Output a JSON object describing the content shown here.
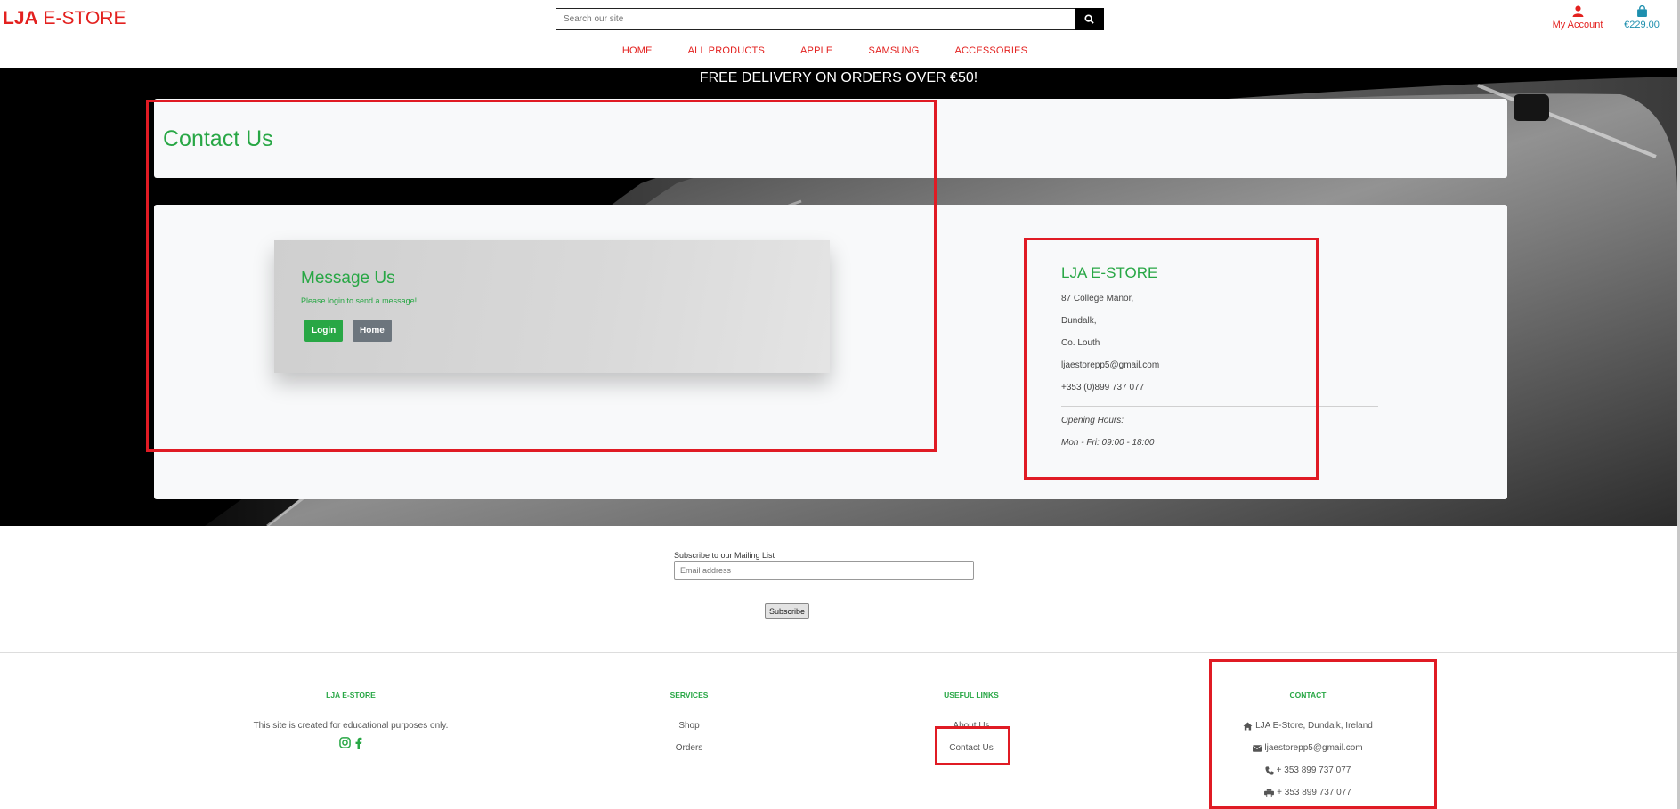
{
  "header": {
    "brand_bold": "LJA",
    "brand_rest": " E-STORE",
    "search_placeholder": "Search our site",
    "account_label": "My Account",
    "cart_total": "€229.00",
    "nav": [
      "HOME",
      "ALL PRODUCTS",
      "APPLE",
      "SAMSUNG",
      "ACCESSORIES"
    ]
  },
  "banner": "FREE DELIVERY ON ORDERS OVER €50!",
  "page_title": "Contact Us",
  "message": {
    "title": "Message Us",
    "note": "Please login to send a message!",
    "login_label": "Login",
    "home_label": "Home"
  },
  "store": {
    "name": "LJA E-STORE",
    "lines": [
      "87 College Manor,",
      "Dundalk,",
      "Co. Louth",
      "ljaestorepp5@gmail.com",
      "+353 (0)899 737 077"
    ],
    "hours_label": "Opening Hours:",
    "hours": "Mon - Fri: 09:00 - 18:00"
  },
  "mailing": {
    "label": "Subscribe to our Mailing List",
    "placeholder": "Email address",
    "button": "Subscribe"
  },
  "footer": {
    "about": {
      "title": "LJA E-STORE",
      "text": "This site is created for educational purposes only.",
      "icons": [
        "instagram-icon",
        "facebook-icon"
      ]
    },
    "services": {
      "title": "SERVICES",
      "links": [
        "Shop",
        "Orders"
      ]
    },
    "useful": {
      "title": "USEFUL LINKS",
      "links": [
        "About Us",
        "Contact Us"
      ]
    },
    "contact": {
      "title": "CONTACT",
      "address": "LJA E-Store, Dundalk, Ireland",
      "email": "ljaestorepp5@gmail.com",
      "phone": "+ 353 899 737 077",
      "fax": "+ 353 899 737 077"
    }
  },
  "colors": {
    "brand_red": "#e3211f",
    "accent_green": "#28a745",
    "cart_blue": "#1e8fae",
    "highlight_red": "#e01b24"
  }
}
